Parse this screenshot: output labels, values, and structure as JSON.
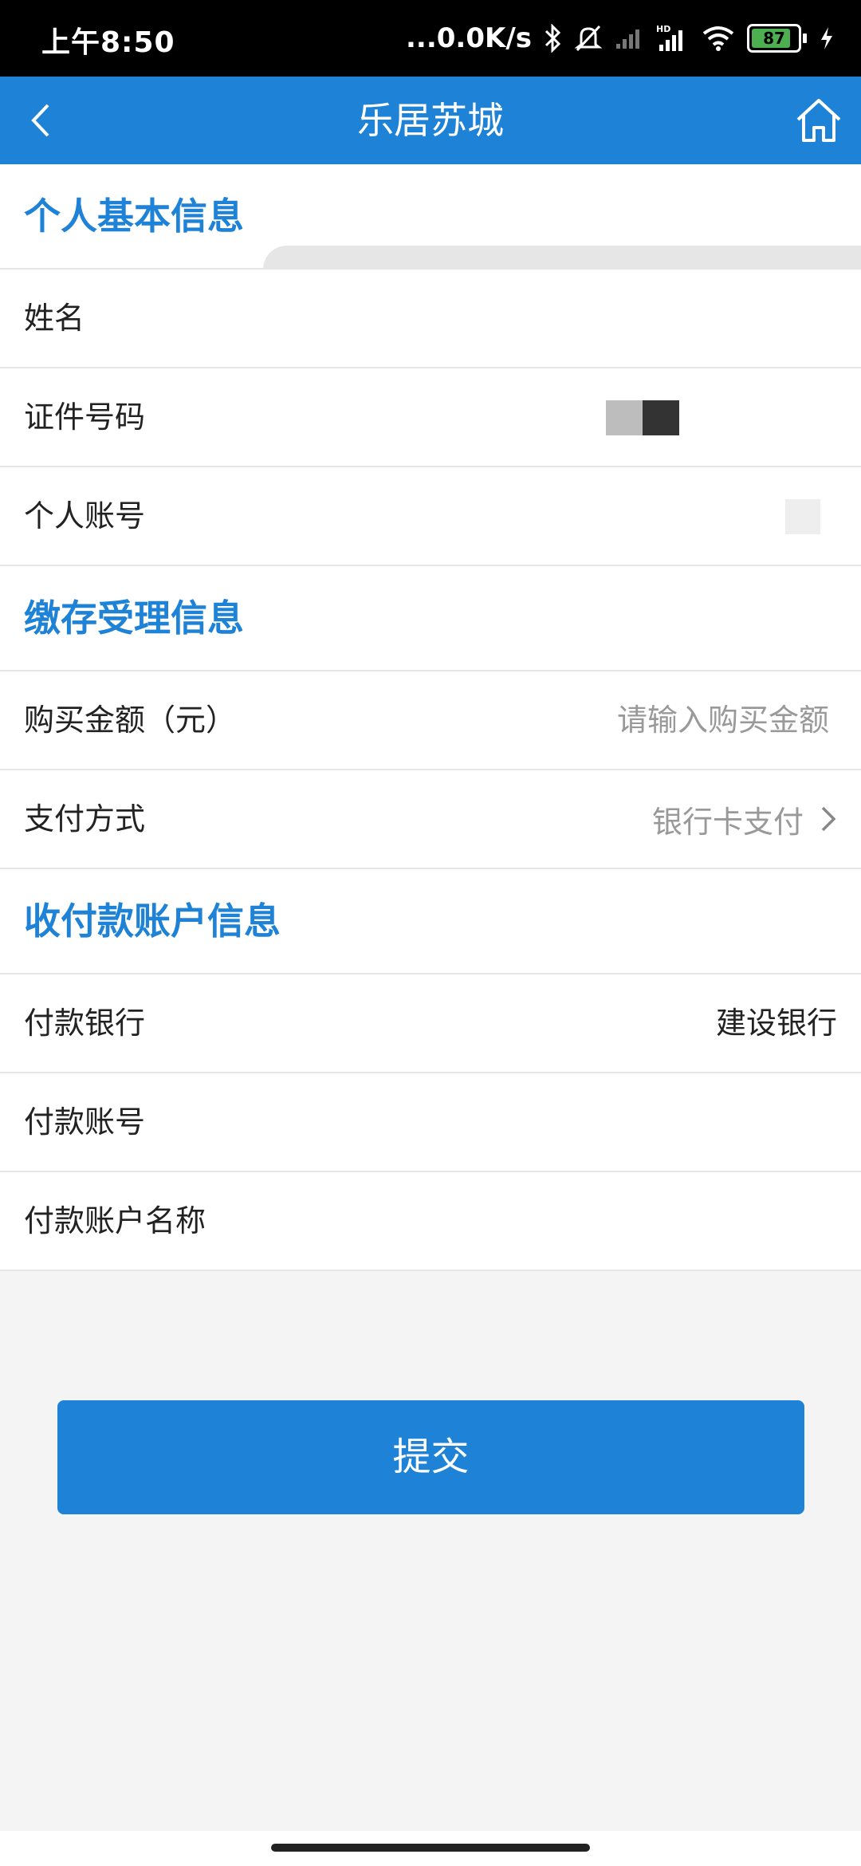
{
  "status_bar": {
    "time": "上午8:50",
    "network_speed": "...0.0K/s",
    "battery_level": "87",
    "icons": [
      "bluetooth-icon",
      "mute-bell-icon",
      "signal-icon",
      "hd-signal-icon",
      "wifi-icon",
      "battery-icon",
      "charging-icon"
    ]
  },
  "nav": {
    "title": "乐居苏城",
    "back_icon": "chevron-left-icon",
    "home_icon": "home-icon"
  },
  "sections": {
    "personal": {
      "title": "个人基本信息",
      "name_label": "姓名",
      "id_label": "证件号码",
      "account_label": "个人账号"
    },
    "deposit": {
      "title": "缴存受理信息",
      "amount_label": "购买金额（元）",
      "amount_placeholder": "请输入购买金额",
      "payment_label": "支付方式",
      "payment_value": "银行卡支付"
    },
    "collection": {
      "title": "收付款账户信息",
      "bank_label": "付款银行",
      "bank_value": "建设银行",
      "account_label": "付款账号",
      "account_name_label": "付款账户名称"
    }
  },
  "submit_label": "提交",
  "colors": {
    "primary": "#1e82d6",
    "background": "#f4f4f4",
    "placeholder": "#999999"
  }
}
